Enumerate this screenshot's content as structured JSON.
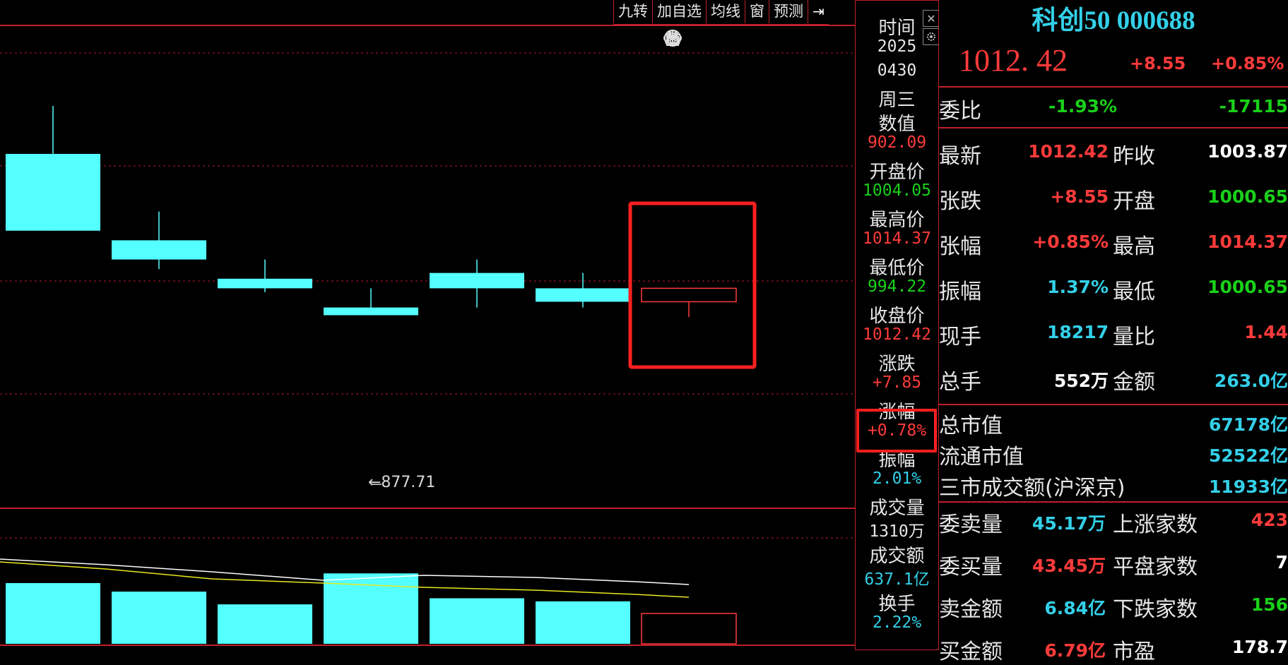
{
  "toolbar": {
    "items": [
      "九转",
      "加自选",
      "均线",
      "窗",
      "预测"
    ],
    "arrow": "⇥"
  },
  "tools": [
    "eye-icon",
    "hand-icon",
    "undo-icon",
    "scissors-icon",
    "lock-icon",
    "zoom-in-icon",
    "zoom-out-icon"
  ],
  "chart_data": {
    "type": "candlestick",
    "candles": [
      {
        "open": 960,
        "high": 985,
        "low": 920,
        "close": 920
      },
      {
        "open": 915,
        "high": 930,
        "low": 900,
        "close": 905
      },
      {
        "open": 895,
        "high": 905,
        "low": 888,
        "close": 890
      },
      {
        "open": 880,
        "high": 890,
        "low": 877.71,
        "close": 876
      },
      {
        "open": 898,
        "high": 905,
        "low": 880,
        "close": 890
      },
      {
        "open": 890,
        "high": 898,
        "low": 880,
        "close": 883
      },
      {
        "open": 883,
        "high": 888,
        "low": 875,
        "close": 890
      }
    ],
    "annotation": "←877.71",
    "volumes": [
      1,
      0.86,
      0.65,
      1.16,
      0.75,
      0.7,
      0.5
    ]
  },
  "info_panel": {
    "rows": [
      {
        "label": "时间",
        "value": "2025"
      },
      {
        "label": "",
        "value": "0430"
      },
      {
        "label": "周三",
        "value": ""
      },
      {
        "label": "数值",
        "value": "902.09"
      },
      {
        "label": "开盘价",
        "value": "1004.05"
      },
      {
        "label": "最高价",
        "value": "1014.37"
      },
      {
        "label": "最低价",
        "value": "994.22"
      },
      {
        "label": "收盘价",
        "value": "1012.42"
      },
      {
        "label": "涨跌",
        "value": "+7.85"
      },
      {
        "label": "涨幅",
        "value": "+0.78%"
      },
      {
        "label": "振幅",
        "value": "2.01%"
      },
      {
        "label": "成交量",
        "value": "1310万"
      },
      {
        "label": "成交额",
        "value": "637.1亿"
      },
      {
        "label": "换手",
        "value": "2.22%"
      }
    ]
  },
  "quote": {
    "title": "科创50 000688",
    "price": "1012. 42",
    "change": "+8.55",
    "change_pct": "+0.85%",
    "weibi": {
      "label": "委比",
      "pct": "-1.93%",
      "diff": "-17115"
    },
    "grid": [
      {
        "l1": "最新",
        "v1": "1012.42",
        "c1": "red",
        "l2": "昨收",
        "v2": "1003.87",
        "c2": "white"
      },
      {
        "l1": "张跌",
        "v1": "+8.55",
        "c1": "red",
        "l2": "开盘",
        "v2": "1000.65",
        "c2": "green"
      },
      {
        "l1": "张幅",
        "v1": "+0.85%",
        "c1": "red",
        "l2": "最高",
        "v2": "1014.37",
        "c2": "red"
      },
      {
        "l1": "振幅",
        "v1": "1.37%",
        "c1": "cyan",
        "l2": "最低",
        "v2": "1000.65",
        "c2": "green"
      },
      {
        "l1": "现手",
        "v1": "18217",
        "c1": "cyan",
        "l2": "量比",
        "v2": "1.44",
        "c2": "red"
      },
      {
        "l1": "总手",
        "v1": "552万",
        "c1": "white",
        "l2": "金额",
        "v2": "263.0亿",
        "c2": "cyan"
      }
    ],
    "market": [
      {
        "label": "总市值",
        "value": "67178亿"
      },
      {
        "label": "流通市值",
        "value": "52522亿"
      },
      {
        "label": "三市成交额(沪深京)",
        "value": "11933亿"
      }
    ],
    "bottom": [
      {
        "l1": "委卖量",
        "v1": "45.17万",
        "c1": "cyan",
        "l2": "上涨家数",
        "v2": "423",
        "c2": "red"
      },
      {
        "l1": "委买量",
        "v1": "43.45万",
        "c1": "red",
        "l2": "平盘家数",
        "v2": "7",
        "c2": "white"
      },
      {
        "l1": "卖金额",
        "v1": "6.84亿",
        "c1": "cyan",
        "l2": "下跌家数",
        "v2": "156",
        "c2": "green"
      },
      {
        "l1": "买金额",
        "v1": "6.79亿",
        "c1": "red",
        "l2": "市盈",
        "v2": "178.7",
        "c2": "white"
      }
    ]
  }
}
